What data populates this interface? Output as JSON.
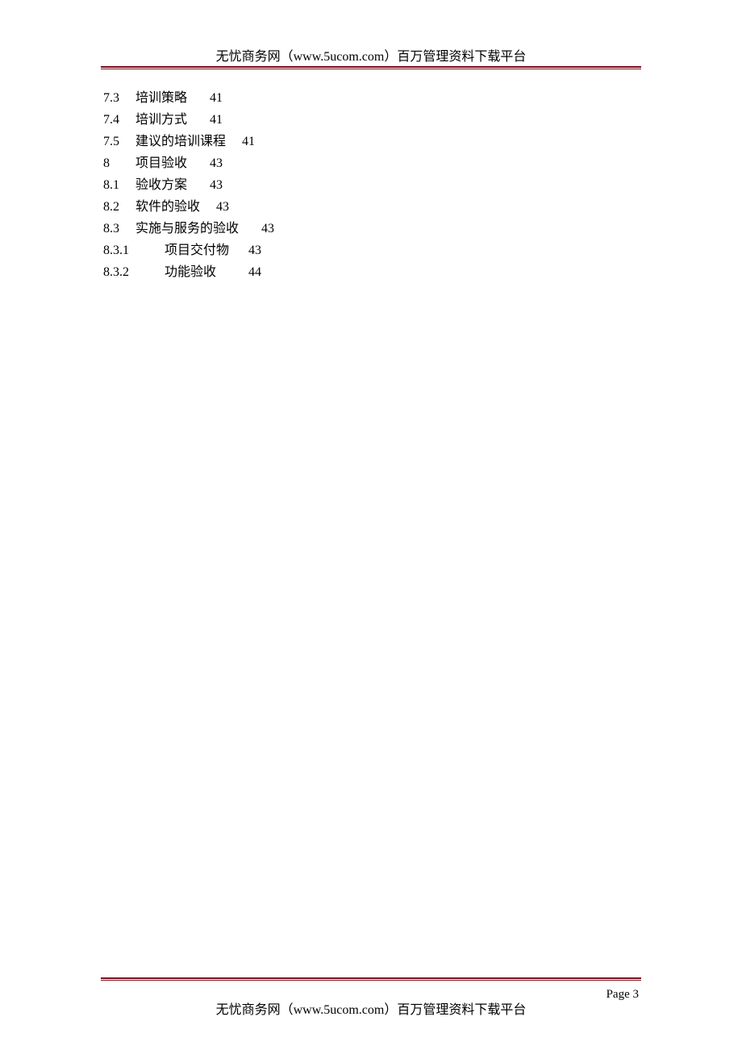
{
  "header": {
    "text": "无忧商务网（www.5ucom.com）百万管理资料下载平台"
  },
  "toc": {
    "entries": [
      {
        "number": "7.3",
        "title": "培训策略",
        "page": "41",
        "indent": 0,
        "num_w": 40,
        "title_w": 92
      },
      {
        "number": "7.4",
        "title": "培训方式",
        "page": "41",
        "indent": 0,
        "num_w": 40,
        "title_w": 92
      },
      {
        "number": "7.5",
        "title": "建议的培训课程",
        "page": "41",
        "indent": 0,
        "num_w": 40,
        "title_w": 132
      },
      {
        "number": "8",
        "title": "项目验收",
        "page": "43",
        "indent": 0,
        "num_w": 40,
        "title_w": 92
      },
      {
        "number": "8.1",
        "title": "验收方案",
        "page": "43",
        "indent": 0,
        "num_w": 40,
        "title_w": 92
      },
      {
        "number": "8.2",
        "title": "软件的验收",
        "page": "43",
        "indent": 0,
        "num_w": 40,
        "title_w": 100
      },
      {
        "number": "8.3",
        "title": "实施与服务的验收",
        "page": "43",
        "indent": 0,
        "num_w": 40,
        "title_w": 156
      },
      {
        "number": "8.3.1",
        "title": "项目交付物",
        "page": "43",
        "indent": 0,
        "num_w": 76,
        "title_w": 104
      },
      {
        "number": "8.3.2",
        "title": "功能验收",
        "page": "44",
        "indent": 0,
        "num_w": 76,
        "title_w": 104
      }
    ]
  },
  "footer": {
    "page_label": "Page 3",
    "text": "无忧商务网（www.5ucom.com）百万管理资料下载平台"
  }
}
